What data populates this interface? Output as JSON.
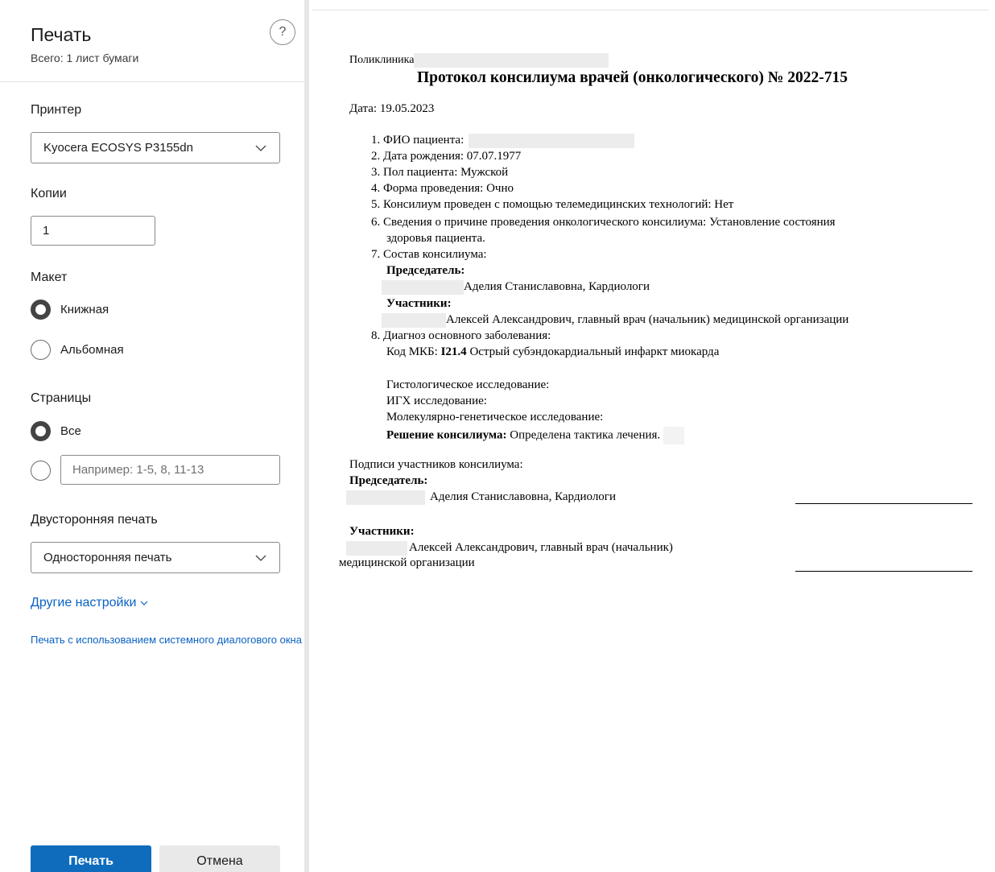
{
  "dialog": {
    "title": "Печать",
    "subtitle": "Всего: 1 лист бумаги",
    "help_label": "?"
  },
  "printer": {
    "label": "Принтер",
    "selected": "Kyocera ECOSYS P3155dn"
  },
  "copies": {
    "label": "Копии",
    "value": "1"
  },
  "layout": {
    "label": "Макет",
    "options": [
      "Книжная",
      "Альбомная"
    ],
    "selected": "Книжная"
  },
  "pages": {
    "label": "Страницы",
    "all_label": "Все",
    "custom_placeholder": "Например: 1-5, 8, 11-13",
    "selected": "Все"
  },
  "duplex": {
    "label": "Двусторонняя печать",
    "selected": "Односторонняя печать"
  },
  "more_settings": "Другие настройки",
  "system_dialog_link": "Печать с использованием системного диалогового окна",
  "buttons": {
    "print": "Печать",
    "cancel": "Отмена"
  },
  "document": {
    "clinic_label": "Поликлиника",
    "title": "Протокол консилиума врачей (онкологического) № 2022-715",
    "date": "Дата: 19.05.2023",
    "items": {
      "i1": "1. ФИО пациента:",
      "i2": "2. Дата рождения: 07.07.1977",
      "i3": "3. Пол пациента: Мужской",
      "i4": "4. Форма проведения: Очно",
      "i5": "5. Консилиум проведен с помощью телемедицинских технологий: Нет",
      "i6a": "6. Сведения о причине проведения онкологического консилиума: Установление состояния",
      "i6b": "здоровья пациента.",
      "i7": "7. Состав консилиума:",
      "chair_label": "Председатель:",
      "chair_name": "Аделия Станиславовна, Кардиологи",
      "members_label": "Участники:",
      "member_name": "Алексей Александрович, главный врач (начальник) медицинской организации",
      "i8": "8. Диагноз основного заболевания:",
      "mkb_prefix": "Код МКБ:",
      "mkb_code": "I21.4",
      "mkb_text": "Острый субэндокардиальный инфаркт миокарда",
      "histology": "Гистологическое исследование:",
      "igh": "ИГХ исследование:",
      "molecular": "Молекулярно-генетическое исследование:",
      "decision_label": "Решение консилиума:",
      "decision_text": "Определена тактика лечения."
    },
    "signatures": {
      "heading": "Подписи участников консилиума:",
      "chair_label": "Председатель:",
      "chair_name": "Аделия Станиславовна, Кардиологи",
      "members_label": "Участники:",
      "member_line1": "Алексей Александрович, главный врач (начальник)",
      "member_line2": "медицинской организации"
    }
  }
}
